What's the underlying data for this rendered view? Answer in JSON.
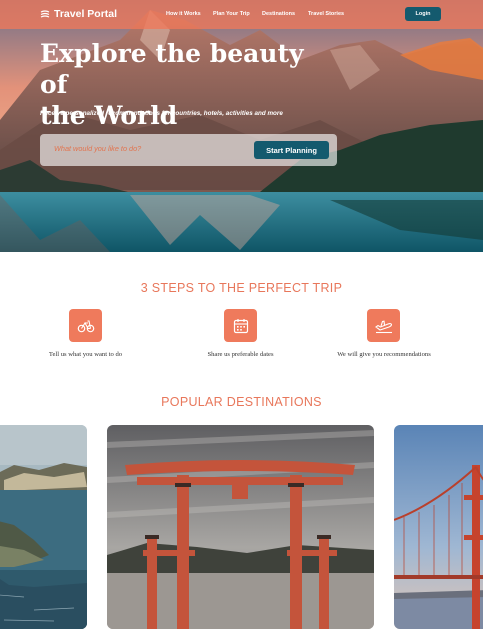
{
  "header": {
    "brand": "Travel Portal",
    "nav": [
      "How it Works",
      "Plan Your Trip",
      "Destinations",
      "Travel Stories"
    ],
    "login_label": "Login"
  },
  "hero": {
    "title_line1": "Explore the beauty of",
    "title_line2": "the World",
    "subtitle": "Receive personalized recommendations for countries, hotels, activities and more",
    "search_placeholder": "What would you like to do?",
    "cta_label": "Start Planning"
  },
  "steps": {
    "title": "3 STEPS TO THE PERFECT TRIP",
    "items": [
      {
        "icon": "bicycle-icon",
        "label": "Tell us what you want to do"
      },
      {
        "icon": "calendar-icon",
        "label": "Share us preferable dates"
      },
      {
        "icon": "plane-icon",
        "label": "We will give you recommendations"
      }
    ]
  },
  "destinations": {
    "title": "POPULAR DESTINATIONS",
    "cards": [
      "coastline-photo",
      "torii-gate-photo",
      "bridge-photo"
    ]
  },
  "colors": {
    "accent": "#ef7a5c",
    "primary_button": "#145a6e",
    "text_dark": "#333333"
  }
}
